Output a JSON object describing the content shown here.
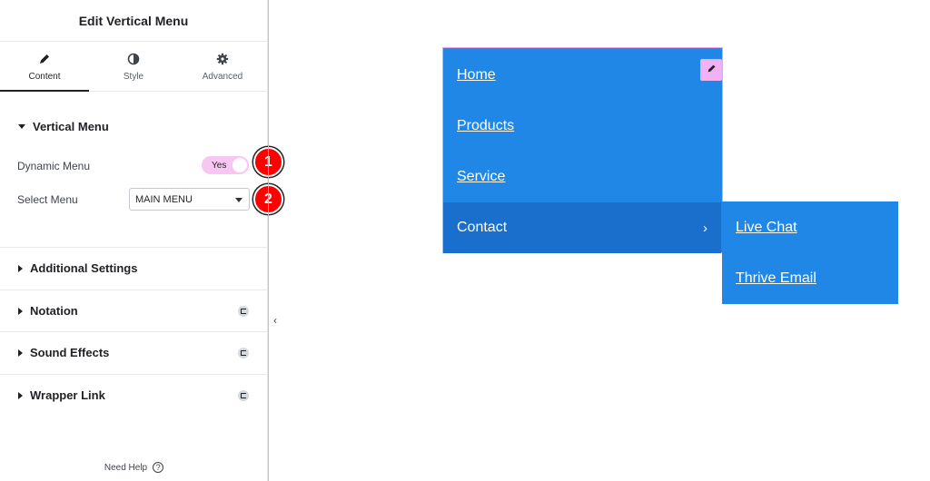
{
  "panel": {
    "title": "Edit Vertical Menu",
    "tabs": [
      {
        "label": "Content",
        "icon": "pencil-icon",
        "active": true
      },
      {
        "label": "Style",
        "icon": "contrast-icon",
        "active": false
      },
      {
        "label": "Advanced",
        "icon": "gear-icon",
        "active": false
      }
    ],
    "section": "Vertical Menu",
    "dynamic_menu": {
      "label": "Dynamic Menu",
      "value": "Yes"
    },
    "select_menu": {
      "label": "Select Menu",
      "value": "MAIN MENU"
    },
    "collapsed_sections": [
      "Additional Settings",
      "Notation",
      "Sound Effects",
      "Wrapper Link"
    ],
    "help": "Need Help",
    "help_icon": "?"
  },
  "badges": [
    "1",
    "2"
  ],
  "menu": {
    "items": [
      {
        "label": "Home"
      },
      {
        "label": "Products"
      },
      {
        "label": "Service"
      },
      {
        "label": "Contact",
        "chevron": "›"
      }
    ],
    "submenu": [
      {
        "label": "Live Chat"
      },
      {
        "label": "Thrive Email"
      }
    ]
  },
  "colors": {
    "menu_bg": "#2187e6",
    "menu_active": "#1a6fcc",
    "accent_pink": "#f7c6f1",
    "badge_red": "#ff0000"
  }
}
